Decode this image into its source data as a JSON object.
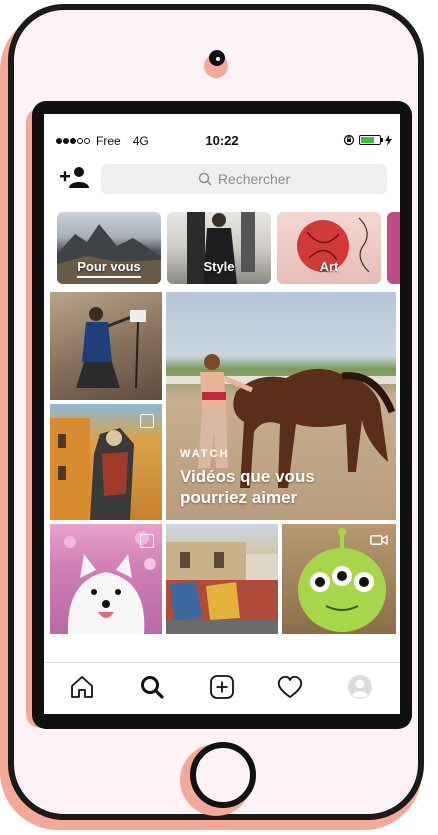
{
  "status": {
    "carrier": "Free",
    "network": "4G",
    "time": "10:22",
    "signal_filled": 3,
    "signal_total": 5
  },
  "search": {
    "placeholder": "Rechercher"
  },
  "categories": [
    {
      "label": "Pour vous",
      "selected": true
    },
    {
      "label": "Style",
      "selected": false
    },
    {
      "label": "Art",
      "selected": false
    }
  ],
  "featured": {
    "eyebrow": "WATCH",
    "title": "Vidéos que vous pourriez aimer"
  },
  "tabs": [
    {
      "icon": "home-icon"
    },
    {
      "icon": "search-icon",
      "active": true
    },
    {
      "icon": "add-post-icon"
    },
    {
      "icon": "heart-icon"
    },
    {
      "icon": "profile-icon"
    }
  ],
  "colors": {
    "accent_outline": "#f6a898",
    "frame": "#1a1a1a",
    "battery": "#3dbf3d"
  }
}
